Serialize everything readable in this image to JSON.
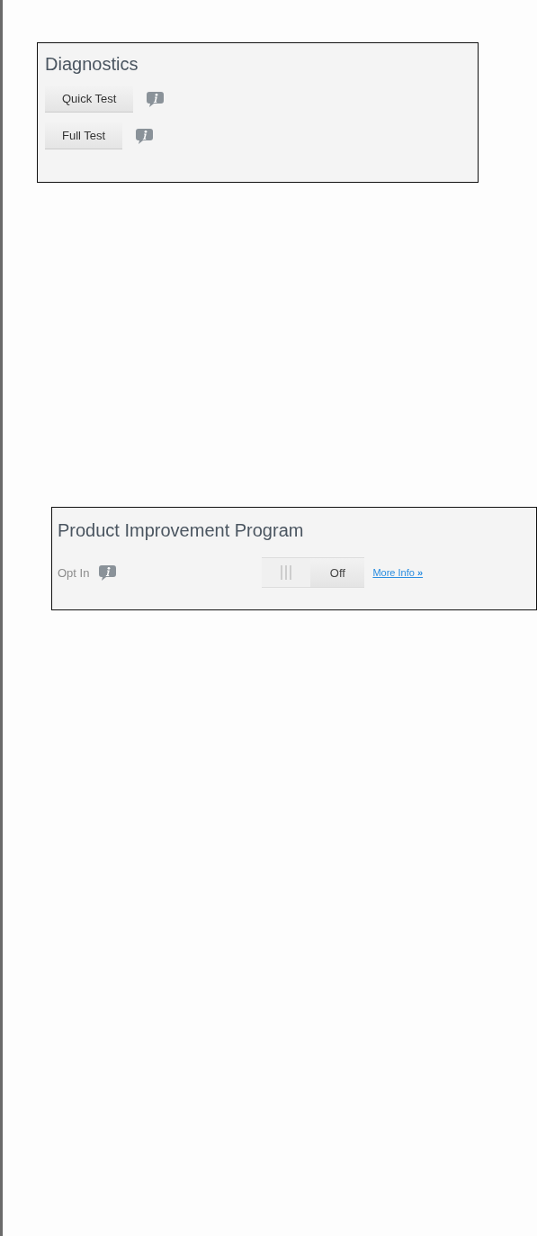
{
  "diagnostics": {
    "title": "Diagnostics",
    "buttons": [
      {
        "label": "Quick Test"
      },
      {
        "label": "Full Test"
      }
    ]
  },
  "product_improvement": {
    "title": "Product Improvement Program",
    "opt_in": {
      "label": "Opt In",
      "toggle": {
        "on": false,
        "label": "Off"
      },
      "link": "More Info **»**"
    }
  }
}
